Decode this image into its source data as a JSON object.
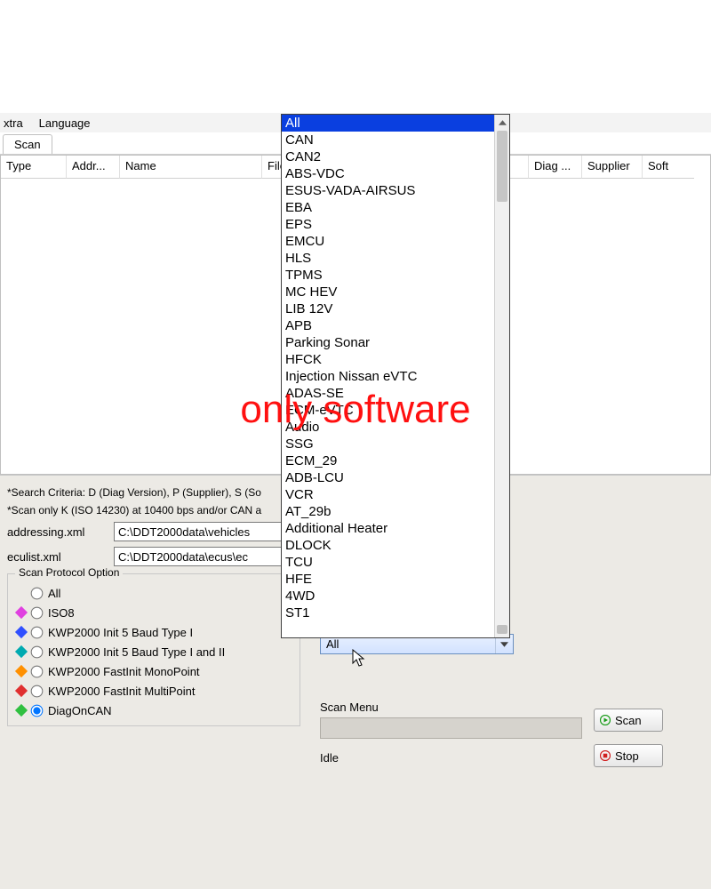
{
  "menu": {
    "extra": "xtra",
    "language": "Language"
  },
  "tab": {
    "scan": "Scan"
  },
  "columns": {
    "type": "Type",
    "addr": "Addr...",
    "name": "Name",
    "file": "File",
    "diag": "Diag ...",
    "supplier": "Supplier",
    "soft": "Soft"
  },
  "notes": {
    "criteria": "*Search Criteria: D (Diag Version), P (Supplier), S (So",
    "scan_only": "*Scan only K (ISO 14230) at 10400 bps and/or CAN a"
  },
  "paths": {
    "addr_label": "addressing.xml",
    "addr_value": "C:\\DDT2000data\\vehicles",
    "ecu_label": "eculist.xml",
    "ecu_value": "C:\\DDT2000data\\ecus\\ec"
  },
  "protocol": {
    "title": "Scan Protocol Option",
    "opts": {
      "all": "All",
      "iso8": "ISO8",
      "kwp_5b_1": "KWP2000 Init 5 Baud Type I",
      "kwp_5b_1_2": "KWP2000 Init 5 Baud Type I and II",
      "kwp_fast_mono": "KWP2000 FastInit MonoPoint",
      "kwp_fast_multi": "KWP2000 FastInit MultiPoint",
      "diag_can": "DiagOnCAN"
    }
  },
  "combo": {
    "value": "All"
  },
  "scanmenu": {
    "label": "Scan Menu",
    "idle": "Idle"
  },
  "buttons": {
    "scan": "Scan",
    "stop": "Stop"
  },
  "watermark": "only software",
  "dropdown": {
    "items": [
      "All",
      "CAN",
      "CAN2",
      "ABS-VDC",
      "ESUS-VADA-AIRSUS",
      "EBA",
      "EPS",
      "EMCU",
      "HLS",
      "TPMS",
      "MC HEV",
      "LIB 12V",
      "APB",
      "Parking Sonar",
      "HFCK",
      "Injection Nissan eVTC",
      "ADAS-SE",
      "ECM-eVTC",
      "Audio",
      "SSG",
      "ECM_29",
      "ADB-LCU",
      "VCR",
      "AT_29b",
      "Additional Heater",
      "DLOCK",
      "TCU",
      "HFE",
      "4WD",
      "ST1"
    ]
  }
}
